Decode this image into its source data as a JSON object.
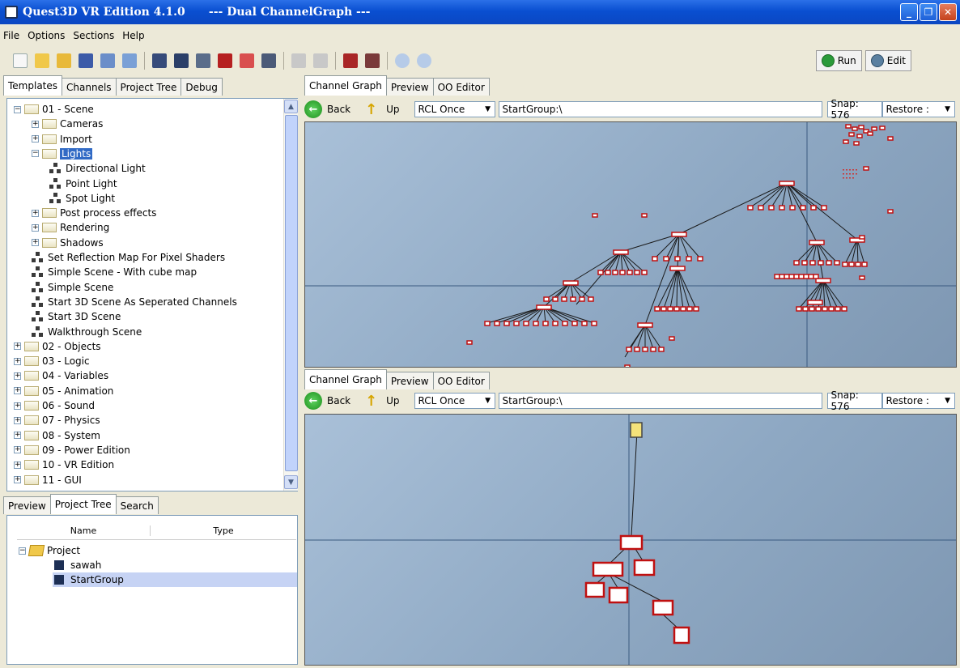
{
  "window": {
    "title": "Quest3D VR Edition 4.1.0      --- Dual ChannelGraph ---"
  },
  "menu": [
    "File",
    "Options",
    "Sections",
    "Help"
  ],
  "run_label": "Run",
  "edit_label": "Edit",
  "left_tabs": [
    "Templates",
    "Channels",
    "Project Tree",
    "Debug"
  ],
  "template_tree": [
    {
      "label": "01 - Scene",
      "level": 0,
      "kind": "folder",
      "toggle": "−"
    },
    {
      "label": "Cameras",
      "level": 1,
      "kind": "folder",
      "toggle": "+"
    },
    {
      "label": "Import",
      "level": 1,
      "kind": "folder",
      "toggle": "+"
    },
    {
      "label": "Lights",
      "level": 1,
      "kind": "folder",
      "toggle": "−",
      "selected": true
    },
    {
      "label": "Directional Light",
      "level": 2,
      "kind": "item"
    },
    {
      "label": "Point Light",
      "level": 2,
      "kind": "item"
    },
    {
      "label": "Spot Light",
      "level": 2,
      "kind": "item"
    },
    {
      "label": "Post process effects",
      "level": 1,
      "kind": "folder",
      "toggle": "+"
    },
    {
      "label": "Rendering",
      "level": 1,
      "kind": "folder",
      "toggle": "+"
    },
    {
      "label": "Shadows",
      "level": 1,
      "kind": "folder",
      "toggle": "+"
    },
    {
      "label": "Set Reflection Map For Pixel Shaders",
      "level": 1,
      "kind": "item"
    },
    {
      "label": "Simple Scene - With cube map",
      "level": 1,
      "kind": "item"
    },
    {
      "label": "Simple Scene",
      "level": 1,
      "kind": "item"
    },
    {
      "label": "Start 3D Scene As Seperated Channels",
      "level": 1,
      "kind": "item"
    },
    {
      "label": "Start 3D Scene",
      "level": 1,
      "kind": "item"
    },
    {
      "label": "Walkthrough Scene",
      "level": 1,
      "kind": "item"
    },
    {
      "label": "02 - Objects",
      "level": 0,
      "kind": "folder",
      "toggle": "+"
    },
    {
      "label": "03 - Logic",
      "level": 0,
      "kind": "folder",
      "toggle": "+"
    },
    {
      "label": "04 - Variables",
      "level": 0,
      "kind": "folder",
      "toggle": "+"
    },
    {
      "label": "05 - Animation",
      "level": 0,
      "kind": "folder",
      "toggle": "+"
    },
    {
      "label": "06 - Sound",
      "level": 0,
      "kind": "folder",
      "toggle": "+"
    },
    {
      "label": "07 - Physics",
      "level": 0,
      "kind": "folder",
      "toggle": "+"
    },
    {
      "label": "08 - System",
      "level": 0,
      "kind": "folder",
      "toggle": "+"
    },
    {
      "label": "09 - Power Edition",
      "level": 0,
      "kind": "folder",
      "toggle": "+"
    },
    {
      "label": "10 - VR Edition",
      "level": 0,
      "kind": "folder",
      "toggle": "+"
    },
    {
      "label": "11 - GUI",
      "level": 0,
      "kind": "folder",
      "toggle": "+"
    }
  ],
  "bottom_tabs": [
    "Preview",
    "Project Tree",
    "Search"
  ],
  "project_tree": {
    "columns": [
      "Name",
      "Type"
    ],
    "root": "Project",
    "items": [
      "sawah",
      "StartGroup"
    ]
  },
  "graph_tabs": [
    "Channel Graph",
    "Preview",
    "OO Editor"
  ],
  "graph_toolbar": {
    "back": "Back",
    "up": "Up",
    "mode": "RCL Once",
    "path": "StartGroup:\\",
    "snap": "Snap: 576",
    "restore": "Restore :"
  }
}
